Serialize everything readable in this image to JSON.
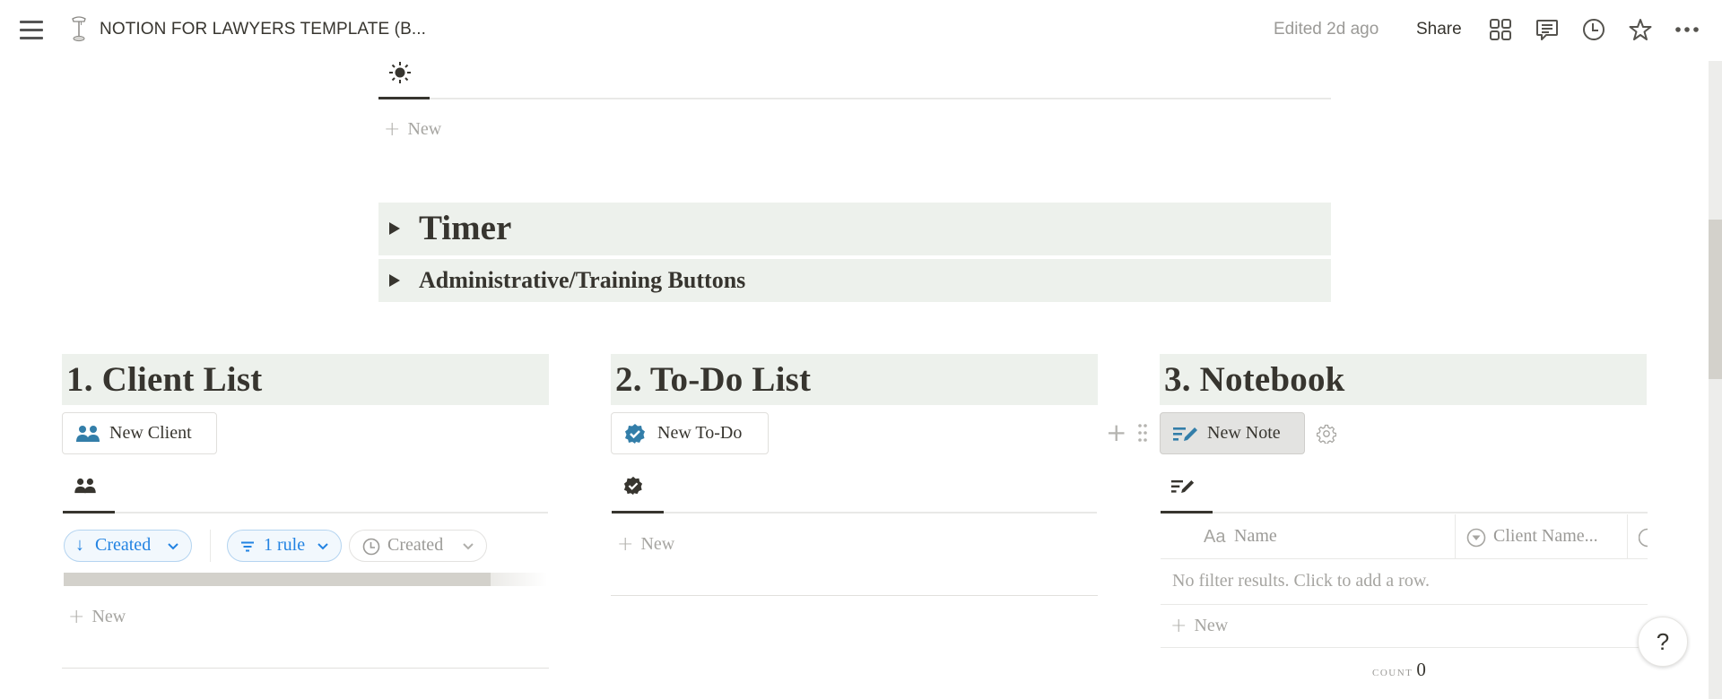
{
  "topbar": {
    "menu_icon": "hamburger-menu-icon",
    "page_icon": "desk-lamp-icon",
    "title": "NOTION FOR LAWYERS TEMPLATE (B...",
    "edited": "Edited 2d ago",
    "share_label": "Share",
    "icons": [
      "layout-grid-icon",
      "comment-icon",
      "clock-history-icon",
      "star-icon",
      "more-icon"
    ]
  },
  "top_gallery": {
    "view_icon": "sun-icon",
    "new_label": "New"
  },
  "toggles": [
    {
      "label": "Timer"
    },
    {
      "label": "Administrative/Training Buttons"
    }
  ],
  "columns": {
    "client_list": {
      "heading": "1. Client List",
      "button_label": "New Client",
      "button_icon": "people-icon",
      "view_icon": "people-icon",
      "sort_chip": "Created",
      "filter_chip": "1 rule",
      "property_chip": "Created",
      "new_label": "New"
    },
    "todo_list": {
      "heading": "2. To-Do List",
      "button_label": "New To-Do",
      "button_icon": "verified-check-icon",
      "view_icon": "verified-check-icon",
      "new_label": "New"
    },
    "notebook": {
      "heading": "3. Notebook",
      "button_label": "New Note",
      "button_icon": "note-edit-icon",
      "view_icon": "note-edit-icon",
      "table": {
        "columns": [
          {
            "icon": "Aa",
            "label": "Name"
          },
          {
            "icon": "select-icon",
            "label": "Client Name..."
          }
        ],
        "empty_message": "No filter results. Click to add a row.",
        "new_label": "New",
        "count_label": "COUNT",
        "count_value": "0"
      }
    }
  },
  "help_label": "?",
  "colors": {
    "heading_bg": "#edf1ec",
    "accent_blue": "#2383e2",
    "icon_blue": "#337ea9",
    "text": "#37352f",
    "muted": "#9b9a97"
  }
}
